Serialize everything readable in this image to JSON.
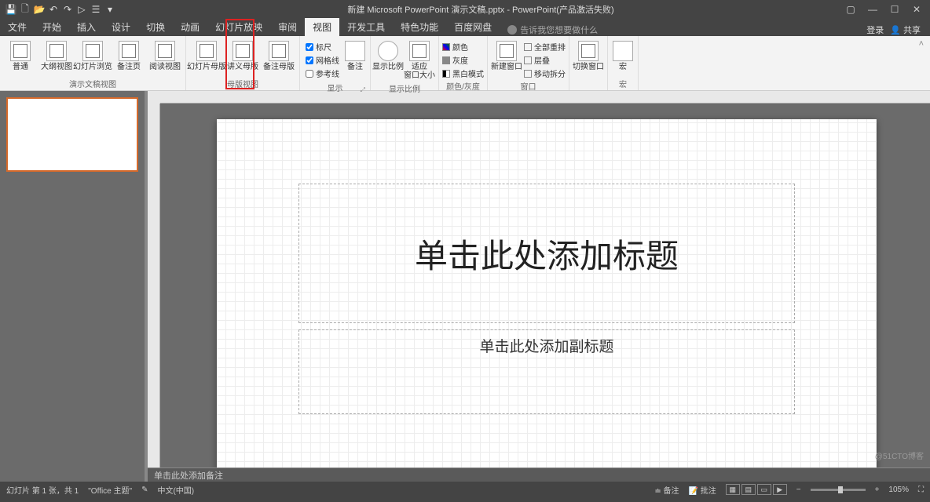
{
  "title": "新建 Microsoft PowerPoint 演示文稿.pptx - PowerPoint(产品激活失败)",
  "qat_icons": [
    "save",
    "new",
    "open",
    "undo",
    "redo",
    "start",
    "touch"
  ],
  "tabs": [
    "文件",
    "开始",
    "插入",
    "设计",
    "切换",
    "动画",
    "幻灯片放映",
    "审阅",
    "视图",
    "开发工具",
    "特色功能",
    "百度网盘"
  ],
  "active_tab": "视图",
  "tellme": "告诉我您想要做什么",
  "menu_right": {
    "login": "登录",
    "share": "共享"
  },
  "ribbon": {
    "group1": {
      "label": "演示文稿视图",
      "btns": [
        "普通",
        "大纲视图",
        "幻灯片浏览",
        "备注页",
        "阅读视图"
      ]
    },
    "group2": {
      "label": "母版视图",
      "btns": [
        "幻灯片母版",
        "讲义母版",
        "备注母版"
      ]
    },
    "group3": {
      "label": "显示",
      "chk": [
        "标尺",
        "网格线",
        "参考线"
      ],
      "btn": "备注"
    },
    "group4": {
      "label": "显示比例",
      "btns": [
        "显示比例",
        "适应\n窗口大小"
      ]
    },
    "group5": {
      "label": "颜色/灰度",
      "items": [
        "颜色",
        "灰度",
        "黑白模式"
      ]
    },
    "group6": {
      "label": "窗口",
      "btn": "新建窗口",
      "items": [
        "全部重排",
        "层叠",
        "移动拆分"
      ]
    },
    "group7": {
      "label": "",
      "btn": "切换窗口"
    },
    "group8": {
      "label": "宏",
      "btn": "宏"
    }
  },
  "slide": {
    "title_ph": "单击此处添加标题",
    "sub_ph": "单击此处添加副标题"
  },
  "notes_ph": "单击此处添加备注",
  "status": {
    "slideinfo": "幻灯片 第 1 张，共 1",
    "theme": "\"Office 主题\"",
    "lang": "中文(中国)",
    "notes": "备注",
    "comments": "批注",
    "zoom": "105%"
  },
  "watermark": "@51CTO博客"
}
